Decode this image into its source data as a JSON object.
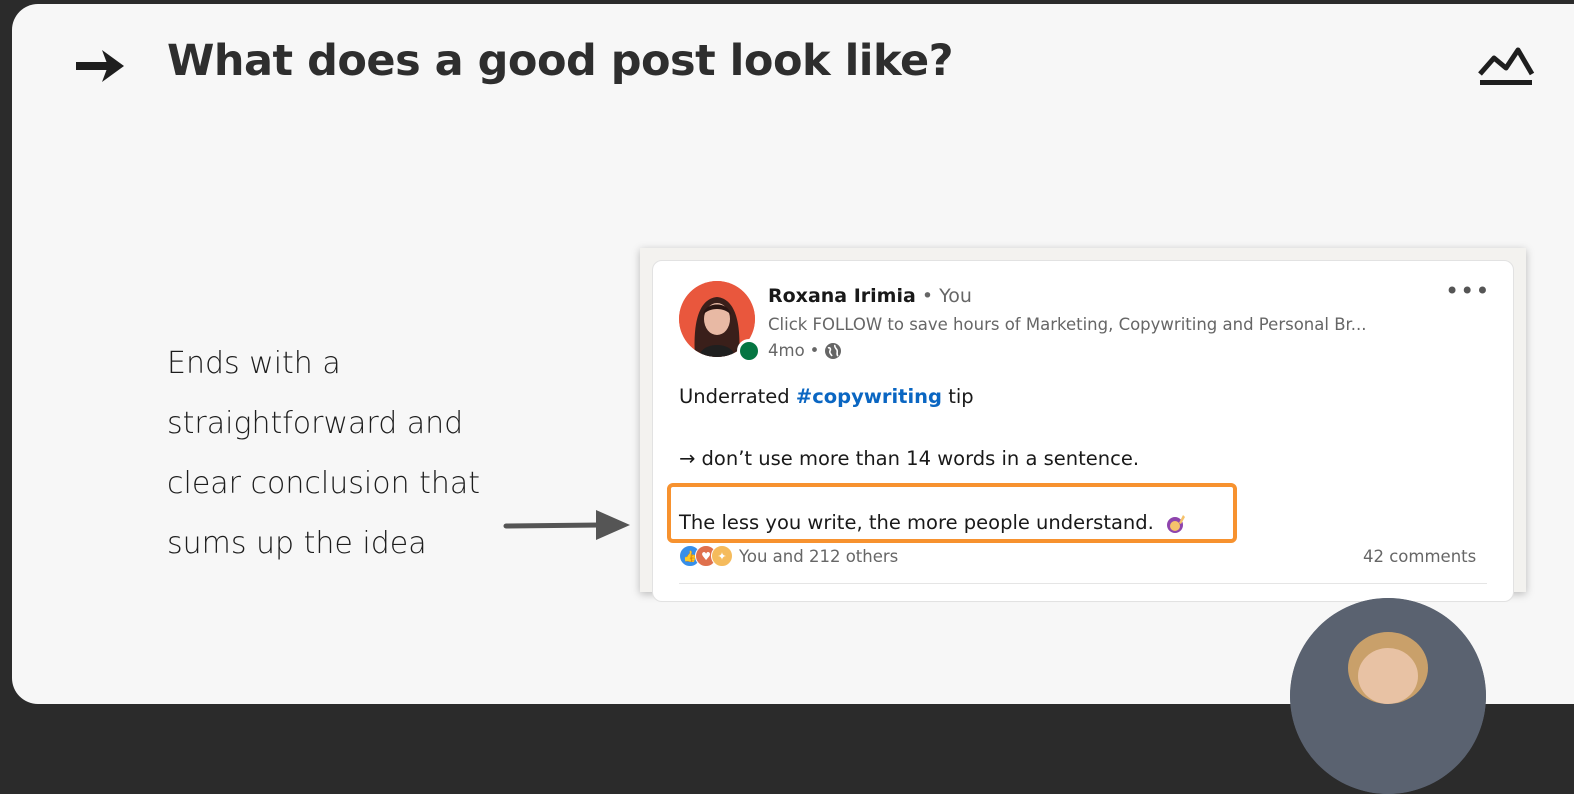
{
  "slide": {
    "title": "What does a good post look like?",
    "title_icon": "arrow-right-icon",
    "corner_icon": "crown-icon",
    "description_lines": [
      "Ends with a",
      "straightforward and",
      "clear conclusion that",
      "sums up the idea"
    ]
  },
  "post": {
    "author_name": "Roxana Irimia",
    "separator": "•",
    "relation": "You",
    "headline": "Click FOLLOW to save hours of Marketing, Copywriting and Personal Br...",
    "age": "4mo",
    "meta_separator": "•",
    "visibility_icon": "globe-icon",
    "more_label": "•••",
    "line1_prefix": "Underrated ",
    "hashtag": "#copywriting",
    "line1_suffix": " tip",
    "line2": "→ don’t use more than 14 words in a sentence.",
    "line3": "The less you write, the more people understand.",
    "reactions_label": "You and 212 others",
    "comments_label": "42 comments"
  },
  "colors": {
    "highlight": "#f7922f",
    "hashtag": "#0a66c2",
    "online": "#057642"
  }
}
